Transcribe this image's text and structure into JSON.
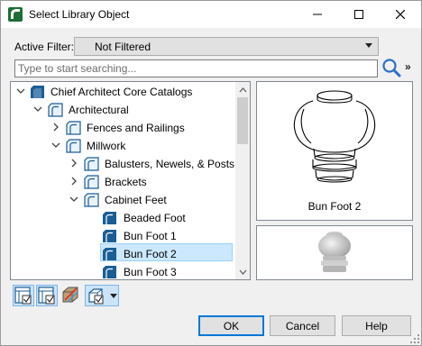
{
  "window": {
    "title": "Select Library Object",
    "icon": "chief-architect-app-icon"
  },
  "filter": {
    "label": "Active Filter:",
    "value": "Not Filtered"
  },
  "search": {
    "placeholder": "Type to start searching...",
    "value": "",
    "more_label": "»"
  },
  "tree": {
    "items": [
      {
        "label": "Chief Architect Core Catalogs",
        "level": 0,
        "expanded": true,
        "type": "catalog-folder"
      },
      {
        "label": "Architectural",
        "level": 1,
        "expanded": true,
        "type": "folder"
      },
      {
        "label": "Fences and Railings",
        "level": 2,
        "expanded": false,
        "type": "folder"
      },
      {
        "label": "Millwork",
        "level": 2,
        "expanded": true,
        "type": "folder"
      },
      {
        "label": "Balusters, Newels, & Posts",
        "level": 3,
        "expanded": false,
        "type": "folder"
      },
      {
        "label": "Brackets",
        "level": 3,
        "expanded": false,
        "type": "folder"
      },
      {
        "label": "Cabinet Feet",
        "level": 3,
        "expanded": true,
        "type": "folder"
      },
      {
        "label": "Beaded Foot",
        "level": 4,
        "type": "object"
      },
      {
        "label": "Bun Foot 1",
        "level": 4,
        "type": "object"
      },
      {
        "label": "Bun Foot 2",
        "level": 4,
        "type": "object",
        "selected": true
      },
      {
        "label": "Bun Foot 3",
        "level": 4,
        "type": "object"
      }
    ]
  },
  "preview": {
    "caption": "Bun Foot 2"
  },
  "toolbar": {
    "buttons": [
      "show-catalog-icon",
      "show-filter-icon",
      "material-icon",
      "place-object-icon"
    ]
  },
  "buttons": {
    "ok": "OK",
    "cancel": "Cancel",
    "help": "Help"
  },
  "colors": {
    "selection": "#cce8ff",
    "default_button_border": "#0078d7",
    "folder_blue": "#1a5e96"
  }
}
